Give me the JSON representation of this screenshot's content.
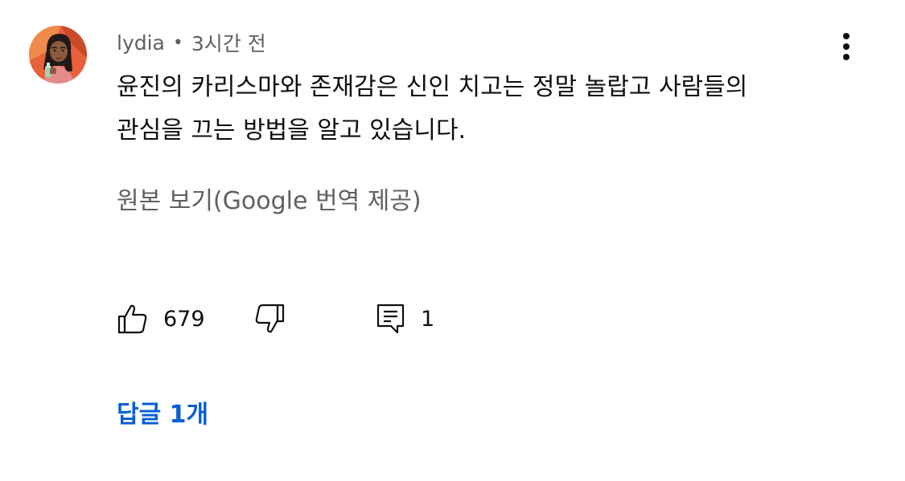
{
  "comment": {
    "author": "lydia",
    "separator": "•",
    "timestamp": "3시간 전",
    "text_lines": [
      "윤진의 카리스마와 존재감은 신인 치고는 정말 놀랍고 사람들의",
      "관심을 끄는 방법을 알고 있습니다."
    ],
    "translate_label": "원본 보기(Google 번역 제공)",
    "like_count": "679",
    "reply_count": "1",
    "replies_link": "답글 1개"
  },
  "icons": {
    "avatar": "avatar-illustration",
    "more": "more-vertical-icon",
    "like": "thumbs-up-icon",
    "dislike": "thumbs-down-icon",
    "reply": "comment-icon"
  },
  "colors": {
    "text": "#0f0f0f",
    "secondary": "#606060",
    "link": "#065fd4",
    "background": "#ffffff"
  }
}
